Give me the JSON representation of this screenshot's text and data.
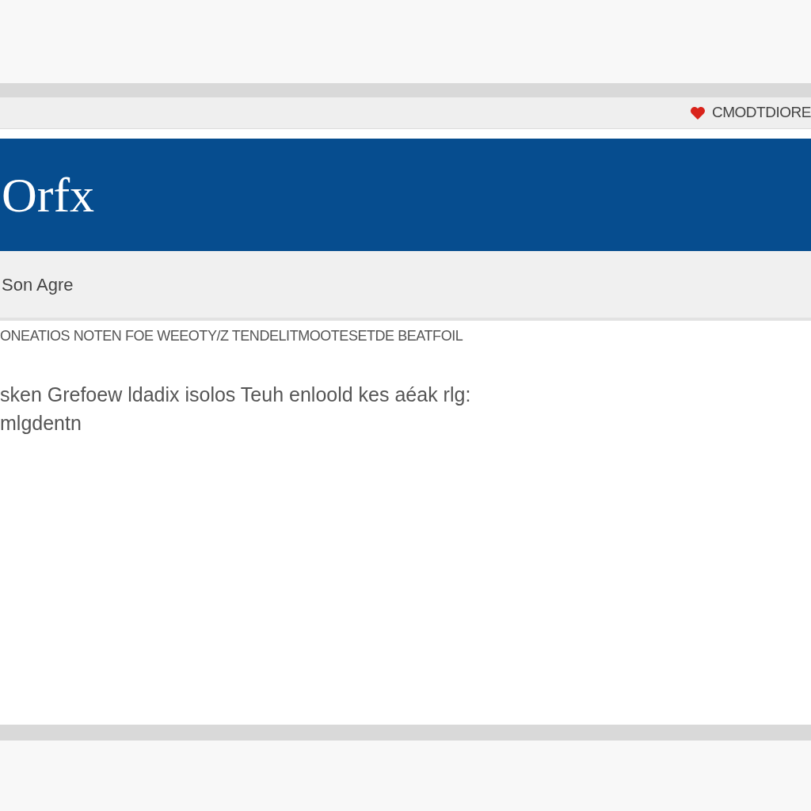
{
  "address_bar": {
    "text": "CMODTDIORE"
  },
  "header": {
    "logo": "Orfx"
  },
  "subheader": {
    "title": "Son Agre"
  },
  "content": {
    "heading": "ONEATIOS NOTEN FOE WEEOTY/Z TENDELITMOOTESETDE BEATFOIL",
    "paragraph": "sken Grefoew ldadix isolos Teuh enloold kes aéak rlg: mlgdentn"
  }
}
